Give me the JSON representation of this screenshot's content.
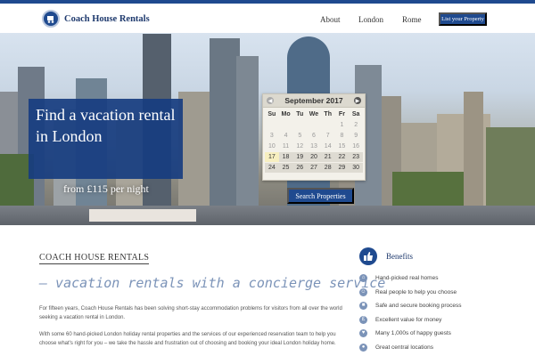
{
  "header": {
    "logo_text": "Coach House Rentals",
    "nav": {
      "about": "About",
      "london": "London",
      "rome": "Rome"
    },
    "list_button": "List your Property"
  },
  "hero": {
    "title": "Find a vacation rental in London",
    "price": "from £115 per night",
    "search_button": "Search Properties"
  },
  "calendar": {
    "month": "September 2017",
    "weekdays": [
      "Su",
      "Mo",
      "Tu",
      "We",
      "Th",
      "Fr",
      "Sa"
    ],
    "days": [
      {
        "d": "",
        "s": "empty"
      },
      {
        "d": "",
        "s": "empty"
      },
      {
        "d": "",
        "s": "empty"
      },
      {
        "d": "",
        "s": "empty"
      },
      {
        "d": "",
        "s": "empty"
      },
      {
        "d": "1",
        "s": "past"
      },
      {
        "d": "2",
        "s": "past"
      },
      {
        "d": "3",
        "s": "past"
      },
      {
        "d": "4",
        "s": "past"
      },
      {
        "d": "5",
        "s": "past"
      },
      {
        "d": "6",
        "s": "past"
      },
      {
        "d": "7",
        "s": "past"
      },
      {
        "d": "8",
        "s": "past"
      },
      {
        "d": "9",
        "s": "past"
      },
      {
        "d": "10",
        "s": "past"
      },
      {
        "d": "11",
        "s": "past"
      },
      {
        "d": "12",
        "s": "past"
      },
      {
        "d": "13",
        "s": "past"
      },
      {
        "d": "14",
        "s": "past"
      },
      {
        "d": "15",
        "s": "past"
      },
      {
        "d": "16",
        "s": "past"
      },
      {
        "d": "17",
        "s": "today"
      },
      {
        "d": "18",
        "s": "active"
      },
      {
        "d": "19",
        "s": "active"
      },
      {
        "d": "20",
        "s": "active"
      },
      {
        "d": "21",
        "s": "active"
      },
      {
        "d": "22",
        "s": "active"
      },
      {
        "d": "23",
        "s": "active"
      },
      {
        "d": "24",
        "s": "active"
      },
      {
        "d": "25",
        "s": "active"
      },
      {
        "d": "26",
        "s": "active"
      },
      {
        "d": "27",
        "s": "active"
      },
      {
        "d": "28",
        "s": "active"
      },
      {
        "d": "29",
        "s": "active"
      },
      {
        "d": "30",
        "s": "active"
      }
    ]
  },
  "intro": {
    "heading": "COACH HOUSE RENTALS",
    "tagline": "– vacation rentals with a concierge service",
    "para1": "For fifteen years, Coach House Rentals has been solving short-stay accommodation problems for visitors from all over the world seeking a vacation rental in London.",
    "para2": "With some 60 hand-picked London holiday rental properties and the services of our experienced reservation team to help you choose what's right for you – we take the hassle and frustration out of choosing and booking your ideal London holiday home."
  },
  "benefits": {
    "title": "Benefits",
    "items": [
      {
        "label": "Hand-picked real homes",
        "icon": "home-icon"
      },
      {
        "label": "Real people to help you choose",
        "icon": "person-icon"
      },
      {
        "label": "Safe and secure booking process",
        "icon": "lock-icon"
      },
      {
        "label": "Excellent value for money",
        "icon": "pound-icon"
      },
      {
        "label": "Many 1,000s of happy guests",
        "icon": "heart-icon"
      },
      {
        "label": "Great central locations",
        "icon": "location-pin-icon"
      }
    ]
  },
  "colors": {
    "brand": "#1f4a8f",
    "accent": "#7b93b8"
  }
}
